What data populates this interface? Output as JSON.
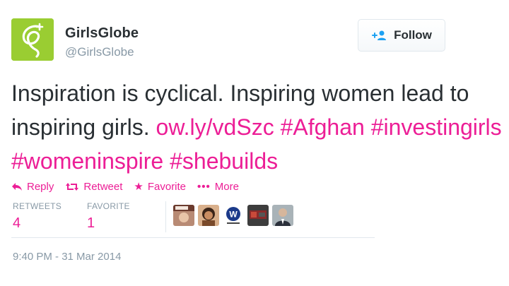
{
  "user": {
    "display_name": "GirlsGlobe",
    "screen_name": "@GirlsGlobe",
    "avatar_color": "#9acd32"
  },
  "follow_button": {
    "label": "Follow"
  },
  "tweet": {
    "text_plain": "Inspiration is cyclical. Inspiring women lead to inspiring girls.",
    "link": "ow.ly/vdSzc",
    "hashtags": [
      "#Afghan",
      "#investingirls",
      "#womeninspire",
      "#shebuilds"
    ]
  },
  "actions": {
    "reply": "Reply",
    "retweet": "Retweet",
    "favorite": "Favorite",
    "more": "More"
  },
  "stats": {
    "retweets_label": "RETWEETS",
    "retweets_count": "4",
    "favorites_label": "FAVORITE",
    "favorites_count": "1"
  },
  "timestamp": "9:40 PM - 31 Mar 2014",
  "colors": {
    "link": "#ec1e96",
    "muted": "#8899a6",
    "text": "#292f33"
  },
  "icons": [
    "reply-icon",
    "retweet-icon",
    "star-icon",
    "ellipsis-icon",
    "add-user-icon"
  ]
}
